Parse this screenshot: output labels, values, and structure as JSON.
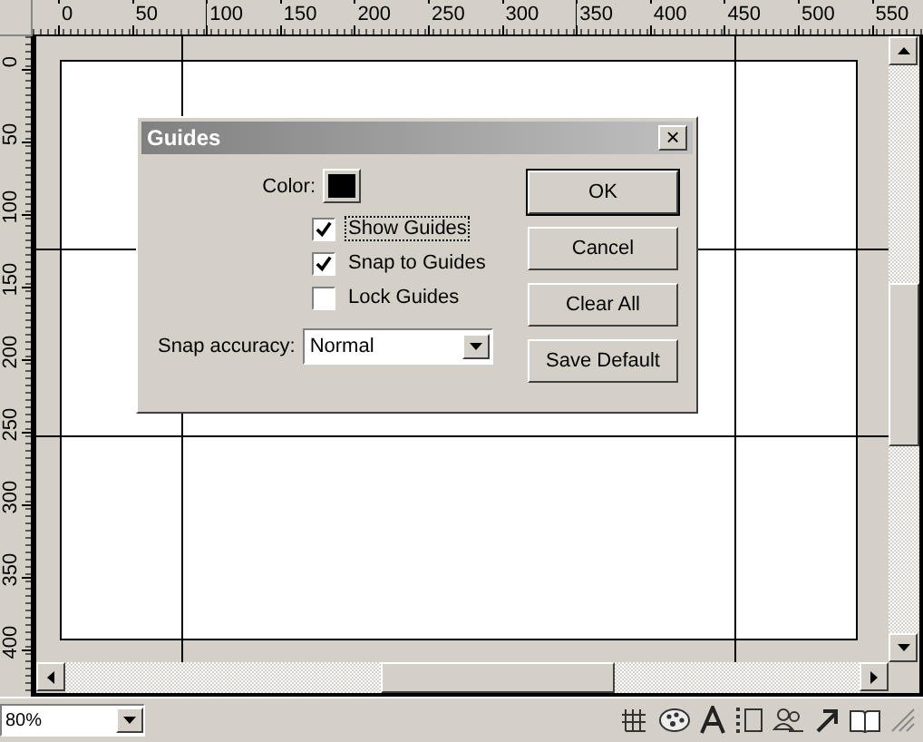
{
  "rulers": {
    "horizontal": [
      "0",
      "50",
      "100",
      "150",
      "200",
      "250",
      "300",
      "350",
      "400",
      "450",
      "500",
      "550"
    ],
    "vertical": [
      "0",
      "50",
      "100",
      "150",
      "200",
      "250",
      "300",
      "350",
      "400"
    ]
  },
  "dialog": {
    "title": "Guides",
    "close": "×",
    "color_label": "Color:",
    "checkboxes": [
      {
        "label": "Show Guides",
        "checked": true,
        "focused": true
      },
      {
        "label": "Snap to Guides",
        "checked": true,
        "focused": false
      },
      {
        "label": "Lock Guides",
        "checked": false,
        "focused": false
      }
    ],
    "snap_label": "Snap accuracy:",
    "snap_value": "Normal",
    "buttons": [
      {
        "label": "OK",
        "default": true
      },
      {
        "label": "Cancel",
        "default": false
      },
      {
        "label": "Clear All",
        "default": false
      },
      {
        "label": "Save Default",
        "default": false
      }
    ]
  },
  "status_bar": {
    "zoom": "80%"
  }
}
